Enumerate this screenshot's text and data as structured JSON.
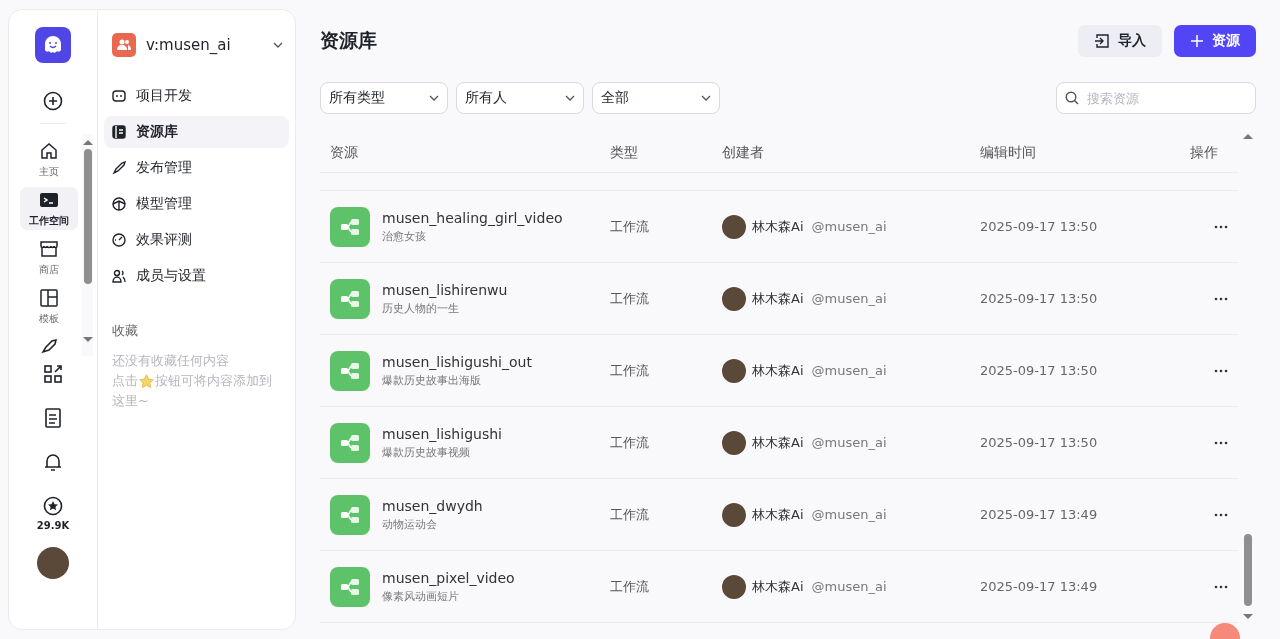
{
  "workspace": {
    "name": "v:musen_ai"
  },
  "rail": {
    "items": [
      {
        "label": "主页",
        "selected": false
      },
      {
        "label": "工作空间",
        "selected": true
      },
      {
        "label": "商店",
        "selected": false
      },
      {
        "label": "模板",
        "selected": false
      }
    ],
    "stat": "29.9K"
  },
  "nav": {
    "items": [
      {
        "label": "项目开发",
        "selected": false
      },
      {
        "label": "资源库",
        "selected": true
      },
      {
        "label": "发布管理",
        "selected": false
      },
      {
        "label": "模型管理",
        "selected": false
      },
      {
        "label": "效果评测",
        "selected": false
      },
      {
        "label": "成员与设置",
        "selected": false
      }
    ]
  },
  "favorites": {
    "title": "收藏",
    "empty": "还没有收藏任何内容",
    "hint_before": "点击",
    "hint_after": "按钮可将内容添加到",
    "hint_end": "这里~"
  },
  "page": {
    "title": "资源库",
    "import_button": "导入",
    "add_button": "资源"
  },
  "filters": [
    "所有类型",
    "所有人",
    "全部"
  ],
  "search": {
    "placeholder": "搜索资源"
  },
  "table": {
    "columns": [
      "资源",
      "类型",
      "创建者",
      "编辑时间",
      "操作"
    ],
    "rows": [
      {
        "name": "musen_healing_girl_video",
        "description": "治愈女孩",
        "type": "工作流",
        "creator": "林木森Ai",
        "handle": "@musen_ai",
        "time": "2025-09-17 13:50"
      },
      {
        "name": "musen_lishirenwu",
        "description": "历史人物的一生",
        "type": "工作流",
        "creator": "林木森Ai",
        "handle": "@musen_ai",
        "time": "2025-09-17 13:50"
      },
      {
        "name": "musen_lishigushi_out",
        "description": "爆款历史故事出海版",
        "type": "工作流",
        "creator": "林木森Ai",
        "handle": "@musen_ai",
        "time": "2025-09-17 13:50"
      },
      {
        "name": "musen_lishigushi",
        "description": "爆款历史故事视频",
        "type": "工作流",
        "creator": "林木森Ai",
        "handle": "@musen_ai",
        "time": "2025-09-17 13:50"
      },
      {
        "name": "musen_dwydh",
        "description": "动物运动会",
        "type": "工作流",
        "creator": "林木森Ai",
        "handle": "@musen_ai",
        "time": "2025-09-17 13:49"
      },
      {
        "name": "musen_pixel_video",
        "description": "像素风动画短片",
        "type": "工作流",
        "creator": "林木森Ai",
        "handle": "@musen_ai",
        "time": "2025-09-17 13:49"
      }
    ]
  }
}
